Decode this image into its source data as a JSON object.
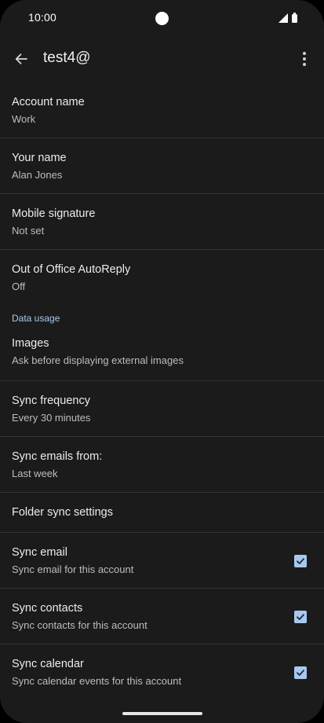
{
  "status_bar": {
    "time": "10:00"
  },
  "app_bar": {
    "title": "test4@",
    "back_icon": "arrow-back-icon",
    "menu_icon": "more-vert-icon"
  },
  "settings": {
    "account_name": {
      "title": "Account name",
      "value": "Work"
    },
    "your_name": {
      "title": "Your name",
      "value": "Alan Jones"
    },
    "mobile_signature": {
      "title": "Mobile signature",
      "value": "Not set"
    },
    "out_of_office": {
      "title": "Out of Office AutoReply",
      "value": "Off"
    },
    "data_usage_header": "Data usage",
    "images": {
      "title": "Images",
      "value": "Ask before displaying external images"
    },
    "sync_frequency": {
      "title": "Sync frequency",
      "value": "Every 30 minutes"
    },
    "sync_emails_from": {
      "title": "Sync emails from:",
      "value": "Last week"
    },
    "folder_sync": {
      "title": "Folder sync settings"
    },
    "sync_email": {
      "title": "Sync email",
      "value": "Sync email for this account",
      "checked": true
    },
    "sync_contacts": {
      "title": "Sync contacts",
      "value": "Sync contacts for this account",
      "checked": true
    },
    "sync_calendar": {
      "title": "Sync calendar",
      "value": "Sync calendar events for this account",
      "checked": true
    }
  },
  "colors": {
    "background": "#1b1b1b",
    "accent": "#a8c8f0",
    "divider": "#333333"
  }
}
